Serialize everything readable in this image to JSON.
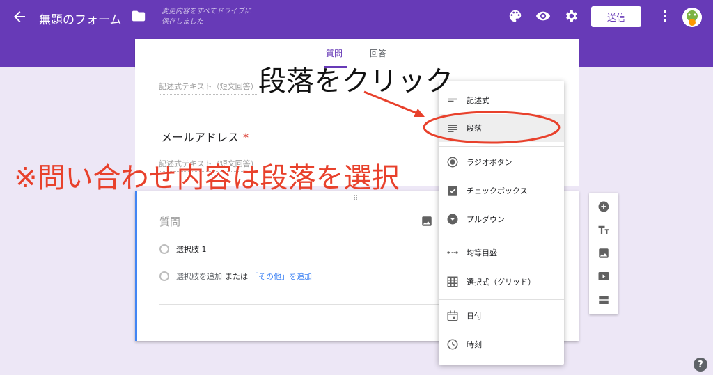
{
  "header": {
    "title": "無題のフォーム",
    "saved_line1": "変更内容をすべてドライブに",
    "saved_line2": "保存しました",
    "send_label": "送信",
    "accent": "#673ab7"
  },
  "tabs": [
    {
      "label": "質問",
      "active": true
    },
    {
      "label": "回答",
      "active": false
    }
  ],
  "form": {
    "short_answer_placeholder": "記述式テキスト（短文回答）",
    "question2_title": "メールアドレス",
    "required_mark": "*",
    "active_question": {
      "placeholder": "質問",
      "option1": "選択肢 1",
      "add_option": "選択肢を追加",
      "or": "または",
      "add_other": "「その他」を追加"
    }
  },
  "menu": {
    "items": [
      {
        "label": "記述式",
        "icon": "short-text-icon"
      },
      {
        "label": "段落",
        "icon": "paragraph-icon",
        "highlighted": true
      },
      {
        "label": "ラジオボタン",
        "icon": "radio-button-icon"
      },
      {
        "label": "チェックボックス",
        "icon": "checkbox-icon"
      },
      {
        "label": "プルダウン",
        "icon": "dropdown-icon"
      },
      {
        "label": "均等目盛",
        "icon": "linear-scale-icon"
      },
      {
        "label": "選択式（グリッド）",
        "icon": "grid-icon"
      },
      {
        "label": "日付",
        "icon": "calendar-icon"
      },
      {
        "label": "時刻",
        "icon": "clock-icon"
      }
    ]
  },
  "annotations": {
    "click_paragraph": "段落をクリック",
    "note": "※問い合わせ内容は段落を選択",
    "color": "#e8412c"
  },
  "help": "?"
}
